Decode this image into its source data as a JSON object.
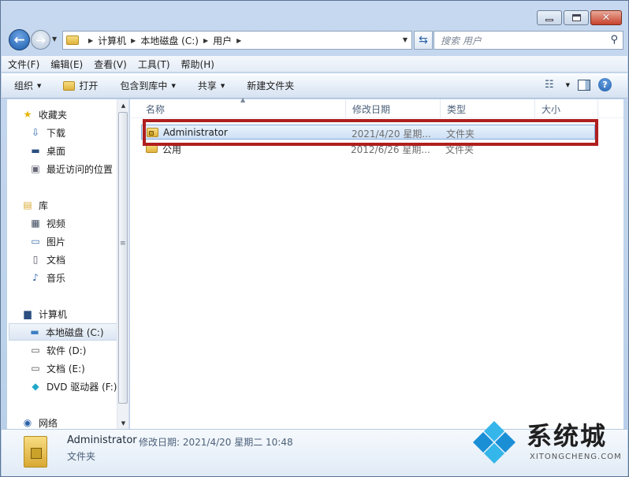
{
  "window": {
    "caption_buttons": [
      "minimize",
      "maximize",
      "close"
    ]
  },
  "address_bar": {
    "crumbs": [
      "计算机",
      "本地磁盘 (C:)",
      "用户"
    ]
  },
  "search": {
    "placeholder": "搜索 用户"
  },
  "menu": [
    "文件(F)",
    "编辑(E)",
    "查看(V)",
    "工具(T)",
    "帮助(H)"
  ],
  "commands": {
    "organize": "组织",
    "open": "打开",
    "include_in_library": "包含到库中",
    "share": "共享",
    "new_folder": "新建文件夹"
  },
  "nav": {
    "favorites": "收藏夹",
    "downloads": "下载",
    "desktop": "桌面",
    "recent": "最近访问的位置",
    "libraries": "库",
    "videos": "视频",
    "pictures": "图片",
    "documents": "文档",
    "music": "音乐",
    "computer": "计算机",
    "drive_c": "本地磁盘 (C:)",
    "drive_d": "软件 (D:)",
    "drive_e": "文档 (E:)",
    "drive_f": "DVD 驱动器 (F:)",
    "network": "网络"
  },
  "columns": [
    "名称",
    "修改日期",
    "类型",
    "大小"
  ],
  "files": [
    {
      "name": "Administrator",
      "modified": "2021/4/20 星期...",
      "type": "文件夹"
    },
    {
      "name": "公用",
      "modified": "2012/6/26 星期...",
      "type": "文件夹"
    }
  ],
  "details": {
    "name": "Administrator",
    "meta": "修改日期: 2021/4/20 星期二 10:48",
    "type": "文件夹"
  },
  "watermark": {
    "text": "系统城",
    "sub": "XITONGCHENG.COM",
    "colors": [
      "#1a8fd6",
      "#35b6ea"
    ]
  },
  "colors": {
    "highlight_box": "#b01e1e",
    "selection": "#cde0f5"
  }
}
